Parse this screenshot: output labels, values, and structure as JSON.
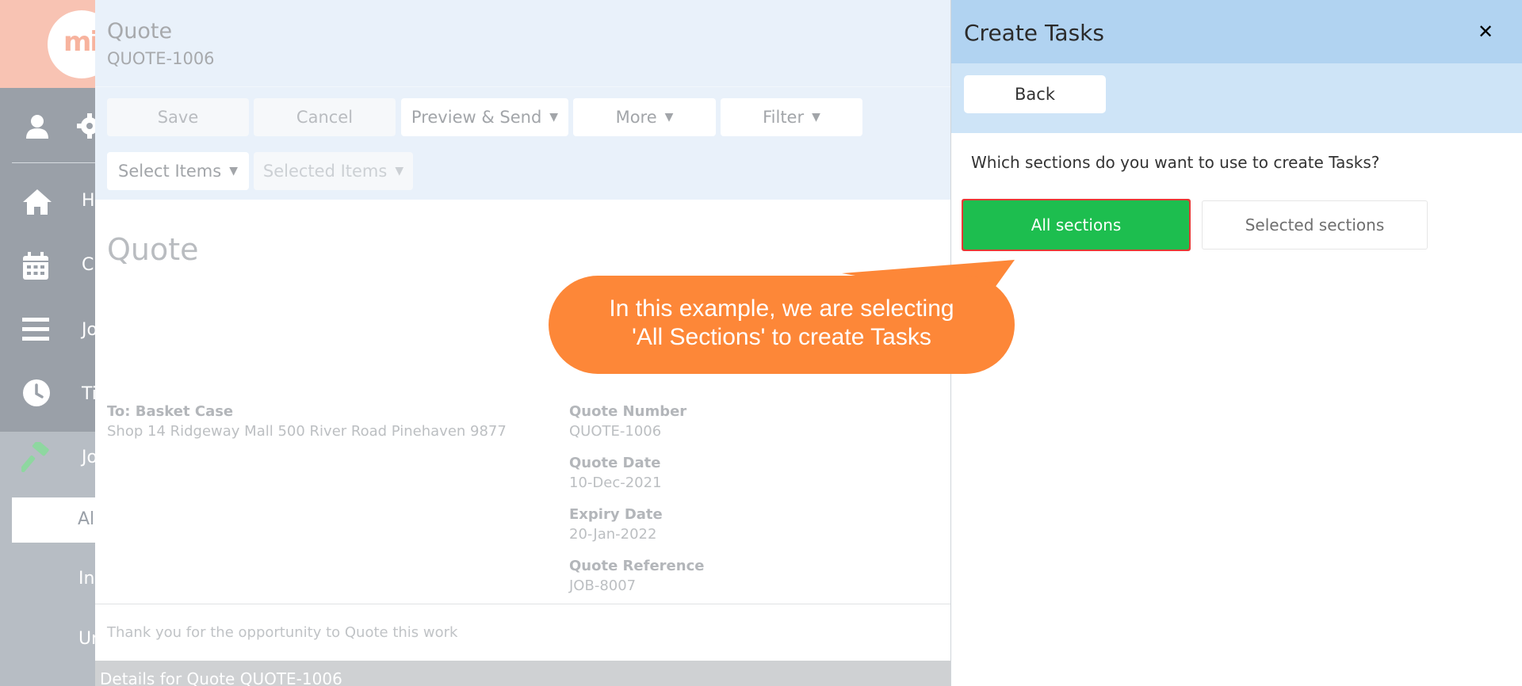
{
  "colors": {
    "accent_green": "#1dbe4f",
    "highlight_red": "#e53935",
    "callout_orange": "#fd8738",
    "panel_header": "#b1d3f1",
    "panel_bar": "#cee4f7"
  },
  "sidebar": {
    "logo_text": "mi",
    "icons": [
      "user-icon",
      "gear-icon",
      "home-icon",
      "calendar-icon",
      "menu-icon",
      "clock-icon",
      "hammer-icon"
    ],
    "items": [
      {
        "label": "H"
      },
      {
        "label": "C"
      },
      {
        "label": "Jo"
      },
      {
        "label": "Ti"
      },
      {
        "label": "Jo"
      }
    ],
    "sub_items": [
      {
        "label": "Al"
      },
      {
        "label": "In"
      },
      {
        "label": "Ur"
      }
    ]
  },
  "quote": {
    "title": "Quote",
    "number": "QUOTE-1006",
    "toolbar": {
      "save": "Save",
      "cancel": "Cancel",
      "preview_send": "Preview & Send",
      "more": "More",
      "filter": "Filter",
      "select_items": "Select Items",
      "selected_items": "Selected Items"
    },
    "heading": "Quote",
    "to_label": "To: Basket Case",
    "to_address": "Shop 14 Ridgeway Mall 500 River Road Pinehaven 9877",
    "fields": [
      {
        "label": "Quote Number",
        "value": "QUOTE-1006"
      },
      {
        "label": "Quote Date",
        "value": "10-Dec-2021"
      },
      {
        "label": "Expiry Date",
        "value": "20-Jan-2022"
      },
      {
        "label": "Quote Reference",
        "value": "JOB-8007"
      }
    ],
    "thanks": "Thank you for the opportunity to Quote this work",
    "details": "Details for Quote QUOTE-1006"
  },
  "panel": {
    "title": "Create Tasks",
    "close": "✕",
    "back": "Back",
    "question": "Which sections do you want to use to create Tasks?",
    "options": {
      "all": "All sections",
      "selected": "Selected sections"
    }
  },
  "callout": {
    "line1": "In this example, we are selecting",
    "line2": "'All Sections' to create Tasks"
  }
}
